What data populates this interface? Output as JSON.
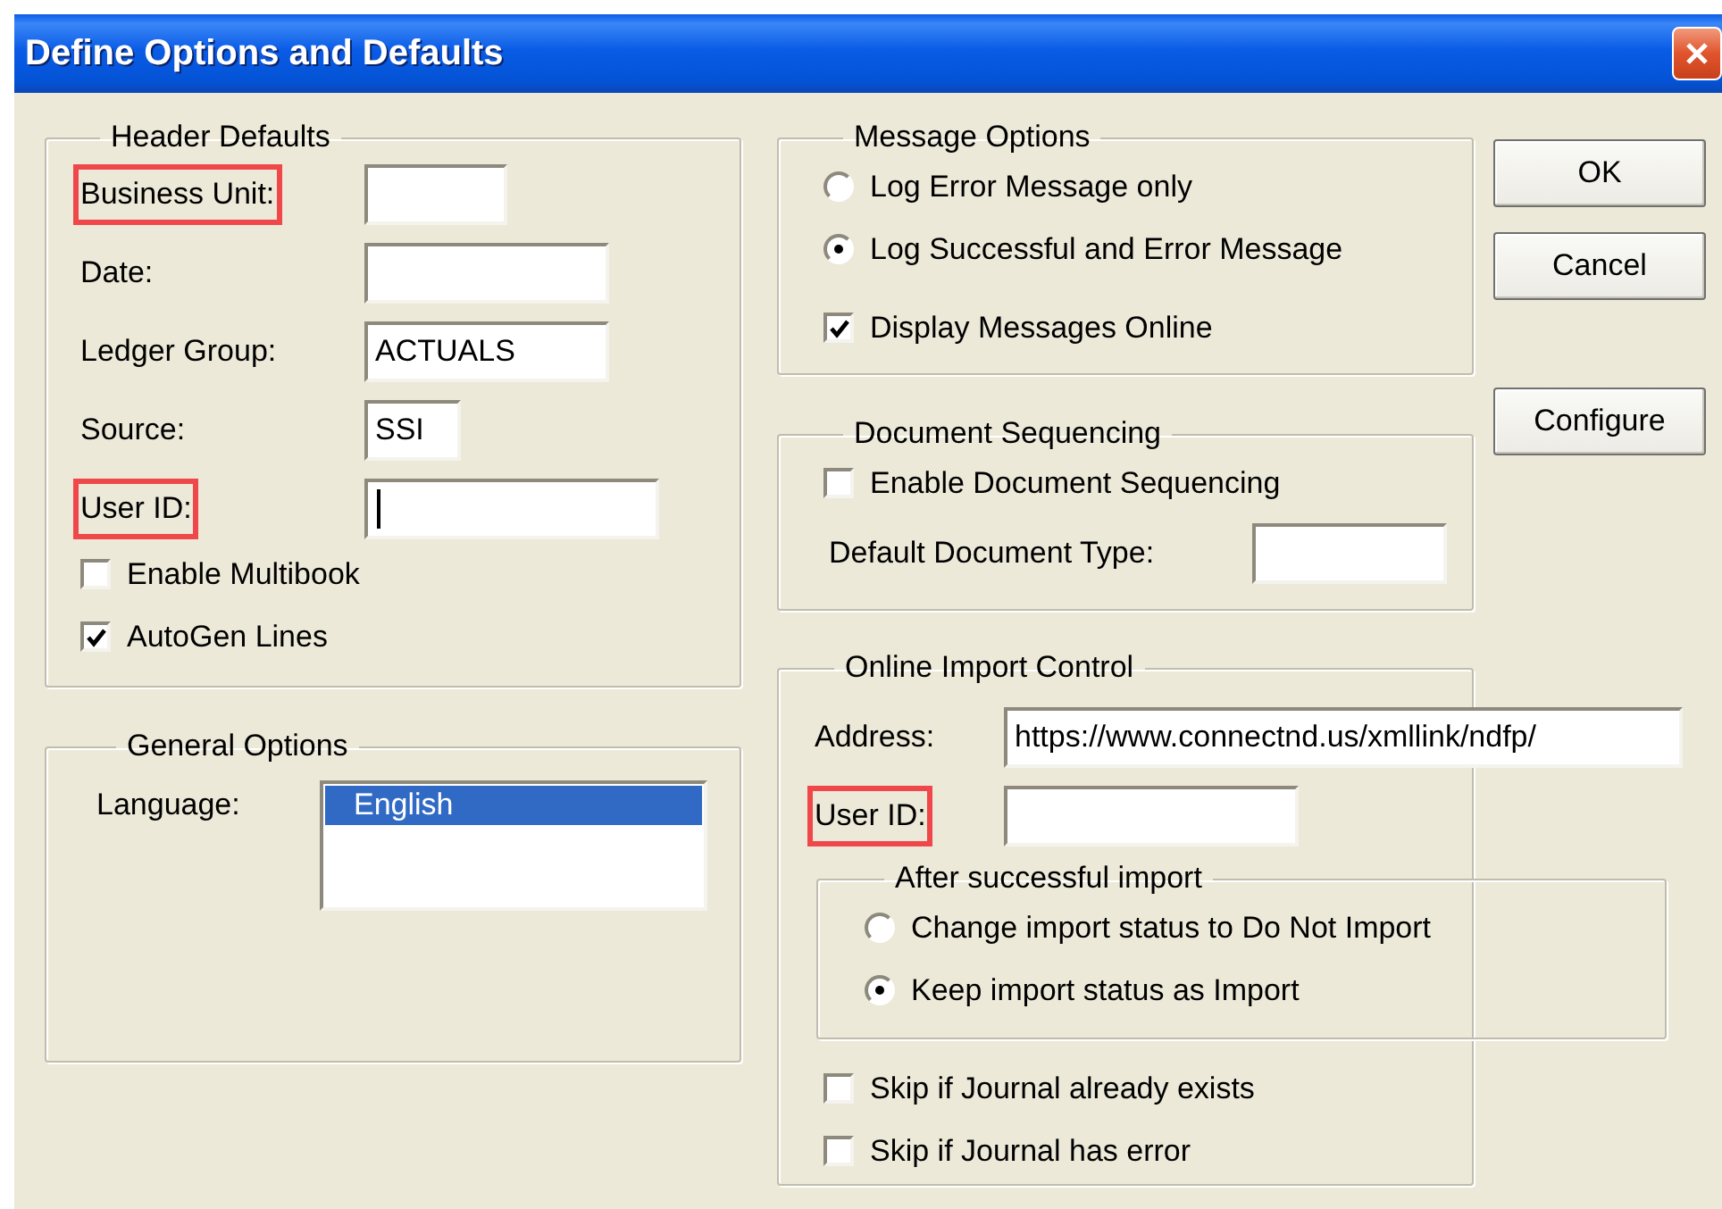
{
  "window": {
    "title": "Define Options and Defaults"
  },
  "header_defaults": {
    "title": "Header Defaults",
    "fields": [
      {
        "label": "Business Unit:",
        "highlighted": true,
        "focused": false
      },
      {
        "label": "Date:",
        "highlighted": false,
        "focused": false
      },
      {
        "label": "Ledger Group:",
        "value": "ACTUALS",
        "highlighted": false,
        "focused": false
      },
      {
        "label": "Source:",
        "value": "SSI",
        "highlighted": false,
        "focused": false
      },
      {
        "label": "User ID:",
        "highlighted": true,
        "focused": true
      }
    ],
    "checkboxes": [
      {
        "label": "Enable Multibook",
        "checked": false
      },
      {
        "label": "AutoGen Lines",
        "checked": true
      }
    ]
  },
  "general_options": {
    "title": "General Options",
    "language_label": "Language:",
    "languages": [
      {
        "label": "English",
        "selected": true
      }
    ]
  },
  "message_options": {
    "title": "Message Options",
    "radios": [
      {
        "label": "Log Error Message only",
        "selected": false
      },
      {
        "label": "Log Successful and Error Message",
        "selected": true
      }
    ],
    "checkboxes": [
      {
        "label": "Display Messages Online",
        "checked": true
      }
    ]
  },
  "document_sequencing": {
    "title": "Document Sequencing",
    "checkboxes": [
      {
        "label": "Enable Document Sequencing",
        "checked": false
      }
    ],
    "fields": [
      {
        "label": "Default Document Type:",
        "highlighted": false,
        "focused": false
      }
    ]
  },
  "online_import_control": {
    "title": "Online Import Control",
    "fields": [
      {
        "label": "Address:",
        "value": "https://www.connectnd.us/xmllink/ndfp/",
        "highlighted": false,
        "focused": false
      },
      {
        "label": "User ID:",
        "highlighted": true,
        "focused": false
      }
    ],
    "after_import": {
      "title": "After successful import",
      "radios": [
        {
          "label": "Change import status to Do Not Import",
          "selected": false
        },
        {
          "label": "Keep import status as Import",
          "selected": true
        }
      ]
    },
    "checkboxes": [
      {
        "label": "Skip if Journal already exists",
        "checked": false
      },
      {
        "label": "Skip if Journal has error",
        "checked": false
      }
    ]
  },
  "buttons": [
    {
      "label": "OK"
    },
    {
      "label": "Cancel"
    },
    {
      "label": "Configure"
    }
  ]
}
